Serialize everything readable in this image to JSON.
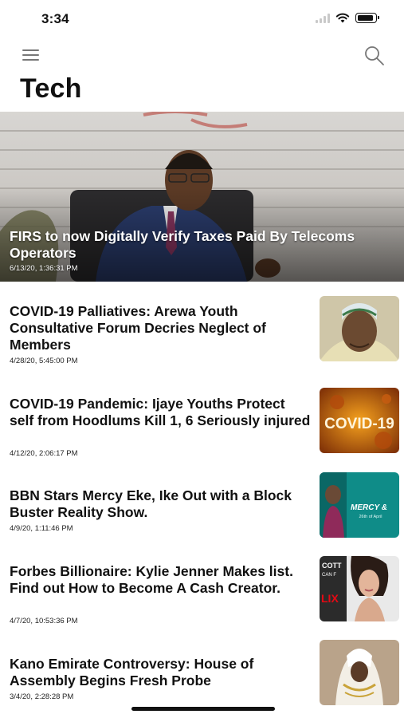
{
  "status_bar": {
    "time": "3:34",
    "icons": [
      "signal-icon",
      "wifi-icon",
      "battery-icon"
    ]
  },
  "nav": {
    "menu_icon": "hamburger-menu-icon",
    "search_icon": "search-icon"
  },
  "page": {
    "title": "Tech"
  },
  "featured": {
    "title": "FIRS to now Digitally Verify Taxes Paid By Telecoms Operators",
    "date": "6/13/20, 1:36:31 PM"
  },
  "articles": [
    {
      "title": "COVID-19 Palliatives: Arewa Youth Consultative Forum Decries Neglect of Members",
      "date": "4/28/20, 5:45:00 PM"
    },
    {
      "title": "COVID-19 Pandemic: Ijaye Youths Protect self from Hoodlums Kill 1, 6 Seriously injured",
      "date": "4/12/20, 2:06:17 PM",
      "thumb_text": "COVID-19"
    },
    {
      "title": "BBN Stars Mercy Eke, Ike Out with a Block Buster Reality Show.",
      "date": "4/9/20, 1:11:46 PM",
      "thumb_text": "MERCY &",
      "thumb_subtext": "26th of April"
    },
    {
      "title": "Forbes Billionaire: Kylie Jenner Makes list. Find out How to Become A Cash Creator.",
      "date": "4/7/20, 10:53:36 PM",
      "thumb_text": "COTT",
      "thumb_subtext": "CAN F",
      "thumb_side": "LIX"
    },
    {
      "title": "Kano Emirate Controversy: House of Assembly Begins Fresh Probe",
      "date": "3/4/20, 2:28:28 PM"
    }
  ],
  "colors": {
    "text": "#111111",
    "background": "#ffffff",
    "secondary_icon": "#777777"
  }
}
